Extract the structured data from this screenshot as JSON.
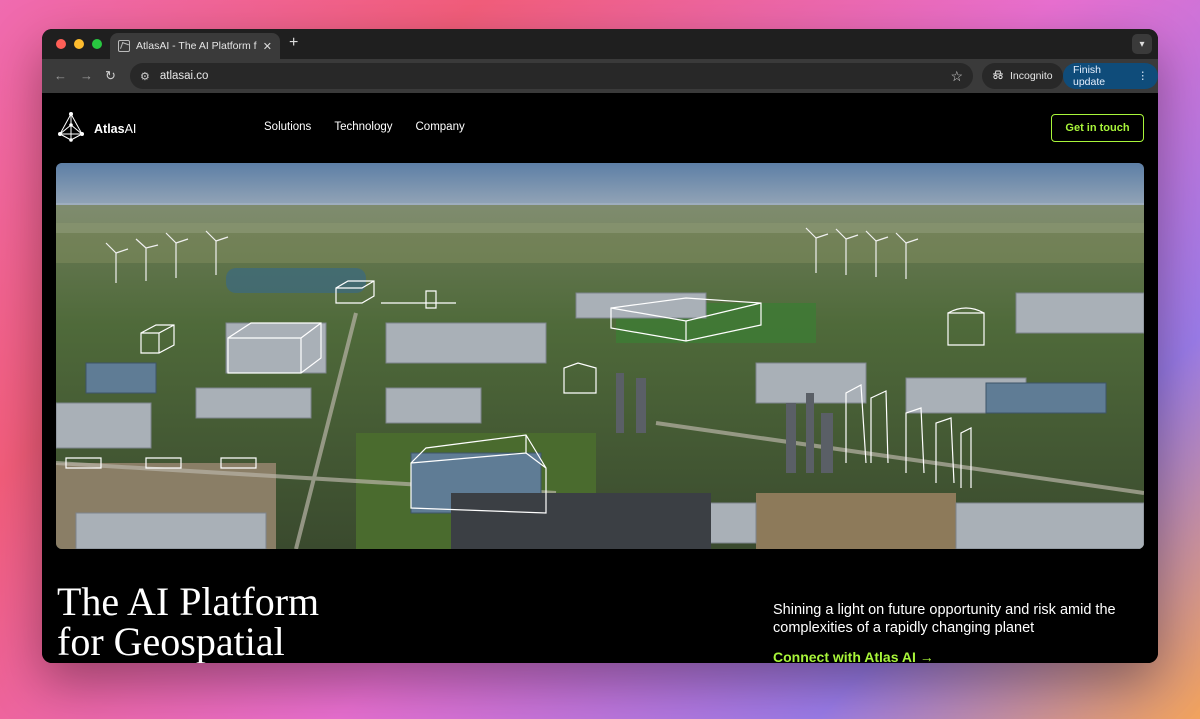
{
  "browser": {
    "tab_title": "AtlasAI - The AI Platform for Geospatial",
    "new_tab": "+",
    "url": "atlasai.co",
    "incognito_label": "Incognito",
    "finish_update_label": "Finish update"
  },
  "site": {
    "logo_bold": "Atlas",
    "logo_light": "AI",
    "nav": [
      "Solutions",
      "Technology",
      "Company"
    ],
    "cta_label": "Get in touch",
    "headline_line1": "The AI Platform",
    "headline_line2": "for Geospatial",
    "tagline": "Shining a light on future opportunity and risk amid the complexities of a rapidly changing planet",
    "connect_label": "Connect with Atlas AI →"
  },
  "colors": {
    "accent": "#a8f53a",
    "update_button": "#0f4c7a"
  },
  "icons": {
    "back": "arrow-left-icon",
    "forward": "arrow-right-icon",
    "reload": "reload-icon",
    "site_settings": "tune-icon",
    "bookmark": "star-icon",
    "incognito": "incognito-icon",
    "menu": "kebab-menu-icon"
  }
}
